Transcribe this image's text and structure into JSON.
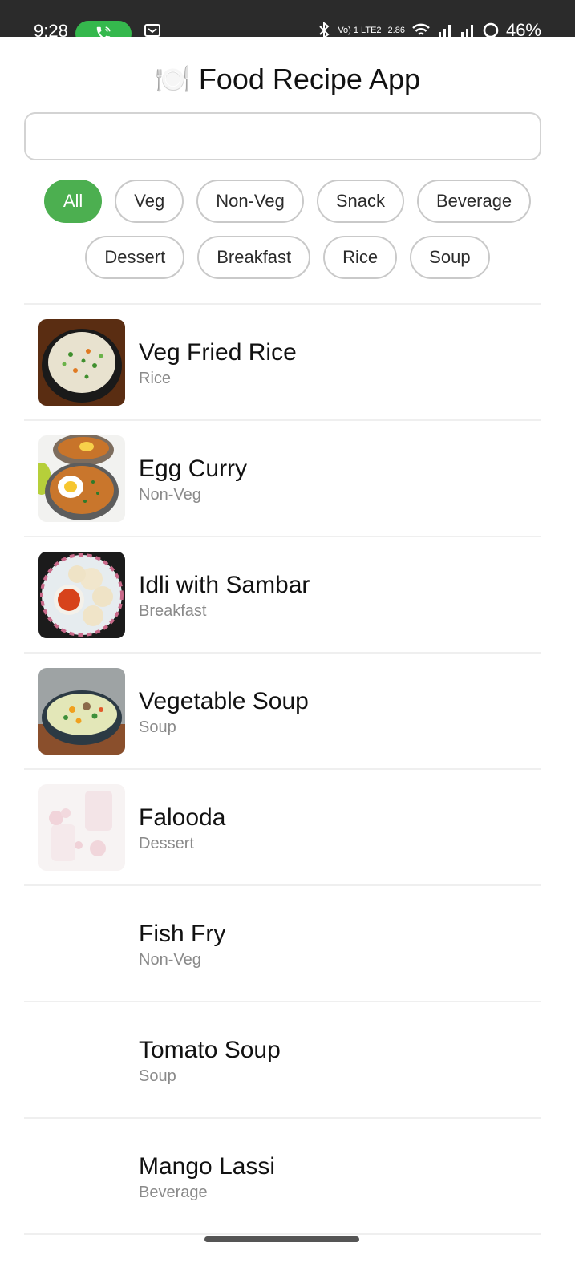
{
  "status_bar": {
    "time": "9:28",
    "network_label": "Vo) 1 LTE2",
    "speed": "2.86",
    "battery": "46%",
    "call_color": "#35b84d"
  },
  "app": {
    "title_emoji": "🍽️",
    "title": "Food Recipe App",
    "search": {
      "value": "",
      "placeholder": ""
    }
  },
  "filters": {
    "active_color": "#4caf50",
    "row1": [
      {
        "label": "All",
        "active": true
      },
      {
        "label": "Veg",
        "active": false
      },
      {
        "label": "Non-Veg",
        "active": false
      },
      {
        "label": "Snack",
        "active": false
      },
      {
        "label": "Beverage",
        "active": false
      }
    ],
    "row2": [
      {
        "label": "Dessert",
        "active": false
      },
      {
        "label": "Breakfast",
        "active": false
      },
      {
        "label": "Rice",
        "active": false
      },
      {
        "label": "Soup",
        "active": false
      }
    ]
  },
  "recipes": [
    {
      "name": "Veg Fried Rice",
      "category": "Rice",
      "image": "fried-rice-photo"
    },
    {
      "name": "Egg Curry",
      "category": "Non-Veg",
      "image": "egg-curry-photo"
    },
    {
      "name": "Idli with Sambar",
      "category": "Breakfast",
      "image": "idli-sambar-photo"
    },
    {
      "name": "Vegetable Soup",
      "category": "Soup",
      "image": "vegetable-soup-photo"
    },
    {
      "name": "Falooda",
      "category": "Dessert",
      "image": "falooda-photo"
    },
    {
      "name": "Fish Fry",
      "category": "Non-Veg",
      "image": ""
    },
    {
      "name": "Tomato Soup",
      "category": "Soup",
      "image": ""
    },
    {
      "name": "Mango Lassi",
      "category": "Beverage",
      "image": ""
    }
  ]
}
